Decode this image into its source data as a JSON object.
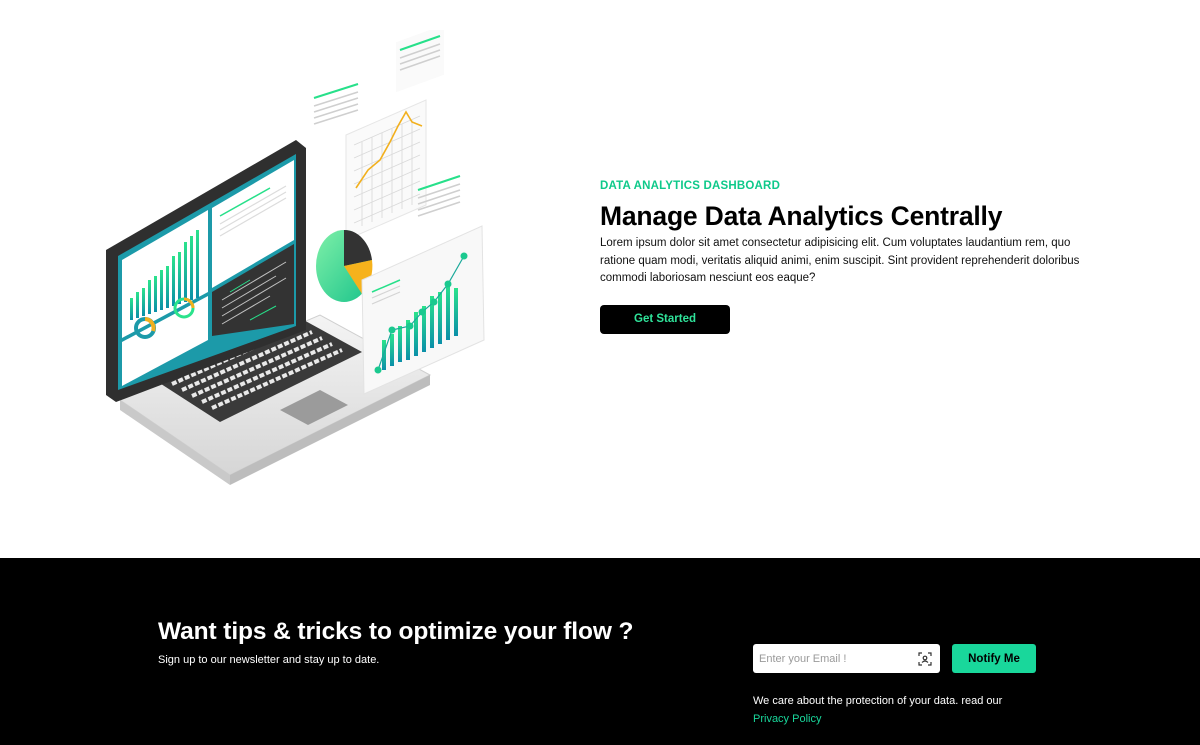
{
  "hero": {
    "eyebrow": "DATA ANALYTICS DASHBOARD",
    "title": "Manage Data Analytics Centrally",
    "description": "Lorem ipsum dolor sit amet consectetur adipisicing elit. Cum voluptates laudantium rem, quo ratione quam modi, veritatis aliquid animi, enim suscipit. Sint provident reprehenderit doloribus commodi laboriosam nesciunt eos eaque?",
    "cta_label": "Get Started",
    "illustration_icon": "laptop-analytics-illustration"
  },
  "newsletter": {
    "title": "Want tips & tricks to optimize your flow ?",
    "subtitle": "Sign up to our newsletter and stay up to date.",
    "email_placeholder": "Enter your Email !",
    "email_value": "",
    "scan_icon": "scan-icon",
    "button_label": "Notify Me",
    "privacy_text": "We care about the protection of your data. read our",
    "privacy_link": "Privacy Policy"
  },
  "colors": {
    "accent": "#19d79b",
    "accent_text": "#0ec98a",
    "footer_bg": "#000000",
    "cta_bg": "#000000",
    "cta_text": "#2fe39a"
  }
}
